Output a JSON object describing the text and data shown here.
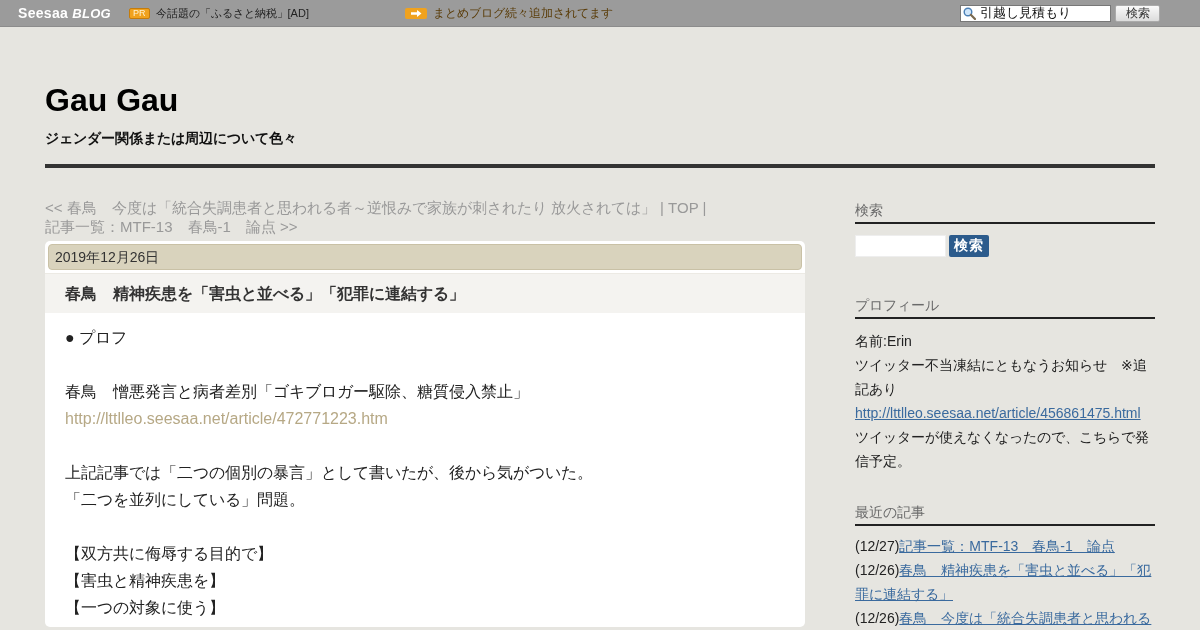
{
  "top_bar": {
    "logo": {
      "brand": "Seesaa",
      "suffix": "BLOG"
    },
    "pr_badge": "PR",
    "ad_text": "今話題の「ふるさと納税」[AD]",
    "notice": "まとめブログ続々追加されてます",
    "search": {
      "value": "引越し見積もり",
      "button": "検索"
    }
  },
  "header": {
    "title": "Gau Gau",
    "subtitle": "ジェンダー関係または周辺について色々"
  },
  "post_nav": [
    {
      "kind": "link",
      "text": "<< 春鳥　今度は「統合失調患者と思われる者～逆恨みで家族が刺されたり 放火されては」"
    },
    {
      "kind": "separator",
      "text": "|"
    },
    {
      "kind": "link",
      "text": "TOP"
    },
    {
      "kind": "separator",
      "text": "|"
    },
    {
      "kind": "link",
      "text": "記事一覧：MTF-13　春鳥-1　論点 >>"
    }
  ],
  "article": {
    "date": "2019年12月26日",
    "title": "春鳥　精神疾患を「害虫と並べる」「犯罪に連結する」",
    "paragraphs": [
      {
        "lines": [
          {
            "kind": "text",
            "text": "● プロフ"
          }
        ]
      },
      {
        "lines": [
          {
            "kind": "text",
            "text": "春鳥　憎悪発言と病者差別「ゴキブロガー駆除、糖質侵入禁止」"
          },
          {
            "kind": "link",
            "text": "http://lttlleo.seesaa.net/article/472771223.htm"
          }
        ]
      },
      {
        "lines": [
          {
            "kind": "text",
            "text": "上記記事では「二つの個別の暴言」として書いたが、後から気がついた。"
          },
          {
            "kind": "text",
            "text": "「二つを並列にしている」問題。"
          }
        ]
      },
      {
        "lines": [
          {
            "kind": "text",
            "text": "【双方共に侮辱する目的で】"
          },
          {
            "kind": "text",
            "text": "【害虫と精神疾患を】"
          },
          {
            "kind": "text",
            "text": "【一つの対象に使う】"
          }
        ]
      }
    ]
  },
  "sidebar": [
    {
      "kind": "search",
      "heading": "検索",
      "button": "検索"
    },
    {
      "kind": "profile",
      "heading": "プロフィール",
      "lines": [
        {
          "kind": "text",
          "text": "名前:Erin"
        },
        {
          "kind": "text",
          "text": "ツイッター不当凍結にともなうお知らせ　※追記あり"
        },
        {
          "kind": "link",
          "text": "http://lttlleo.seesaa.net/article/456861475.html"
        },
        {
          "kind": "text",
          "text": "ツイッターが使えなくなったので、こちらで発信予定。"
        }
      ]
    },
    {
      "kind": "recent",
      "heading": "最近の記事",
      "items": [
        {
          "date": "(12/27)",
          "title": "記事一覧：MTF-13　春鳥-1　論点"
        },
        {
          "date": "(12/26)",
          "title": "春鳥　精神疾患を「害虫と並べる」「犯罪に連結する」"
        },
        {
          "date": "(12/26)",
          "title": "春鳥　今度は「統合失調患者と思われる"
        }
      ]
    }
  ]
}
